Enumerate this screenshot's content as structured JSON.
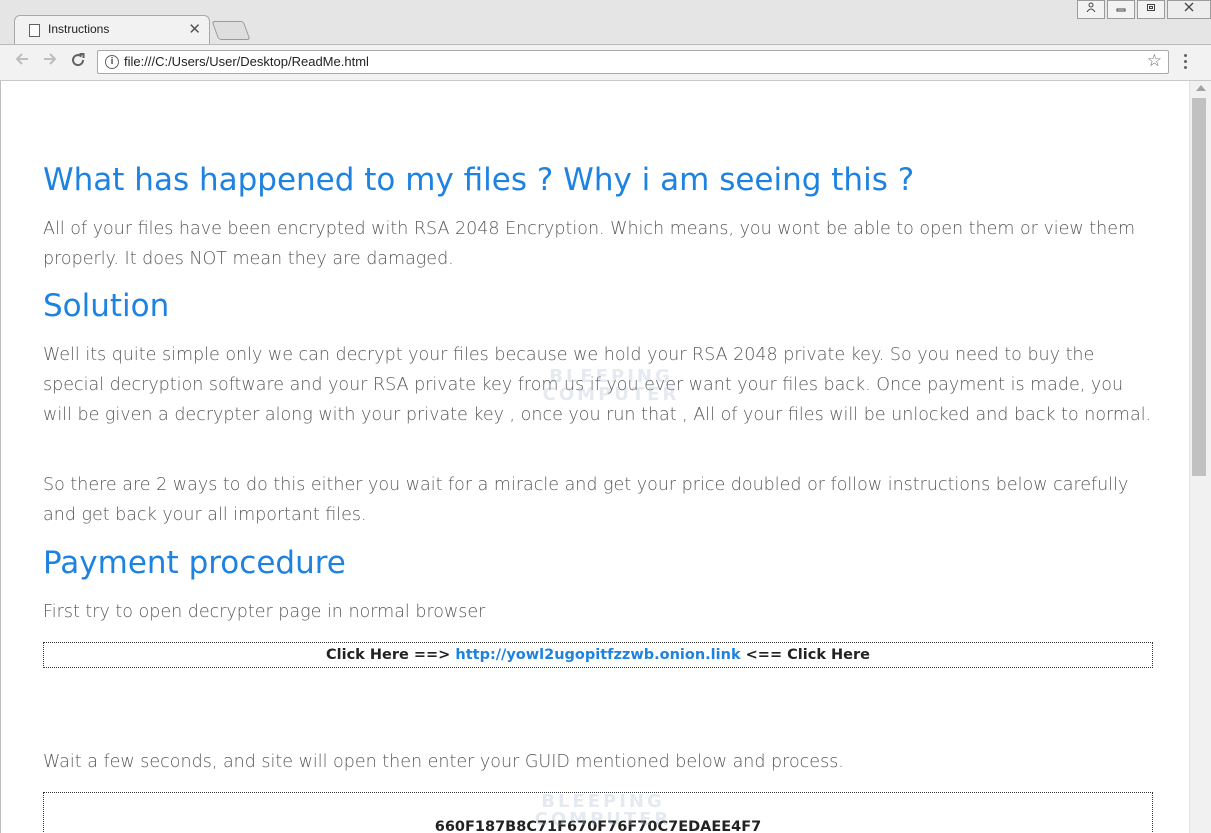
{
  "browser": {
    "tab_title": "Instructions",
    "tab_close": "✕",
    "url": "file:///C:/Users/User/Desktop/ReadMe.html",
    "back_icon": "arrow-left-icon",
    "forward_icon": "arrow-right-icon",
    "reload_icon": "reload-icon",
    "window_buttons": [
      "user-icon",
      "minimize-icon",
      "restore-icon",
      "close-icon"
    ]
  },
  "content": {
    "heading1": "What has happened to my files ? Why i am seeing this ?",
    "para1": "All of your files have been encrypted with RSA 2048 Encryption. Which means, you wont be able to open them or view them properly.   It does NOT mean they are damaged.",
    "heading2": "Solution",
    "para2": "Well its quite simple only we can decrypt your files because we hold your RSA 2048 private key. So you need to buy the special decryption software and your RSA private key from us if you ever want your files back. Once payment is made, you will be given a decrypter along with your private key , once you run that , All of your files will be unlocked and back to normal.",
    "para3": "So there are 2 ways to do this either you wait for a miracle and get your price doubled or follow instructions below carefully and get back your all important files.",
    "heading3": "Payment procedure",
    "para4": "First try to open decrypter page in normal browser",
    "link_prefix": "Click Here ==>",
    "link_url": "http://yowl2ugopitfzzwb.onion.link",
    "link_suffix": "<== Click Here",
    "para5": "Wait a few seconds, and site will open then enter your GUID mentioned below and process.",
    "guid": "660F187B8C71F670F76F70C7EDAEE4F7"
  },
  "watermark": {
    "line1": "BLEEPING",
    "line2": "COMPUTER"
  },
  "colors": {
    "heading": "#1e82e0",
    "link": "#1e82e0",
    "body_text": "#5a5a5a"
  }
}
